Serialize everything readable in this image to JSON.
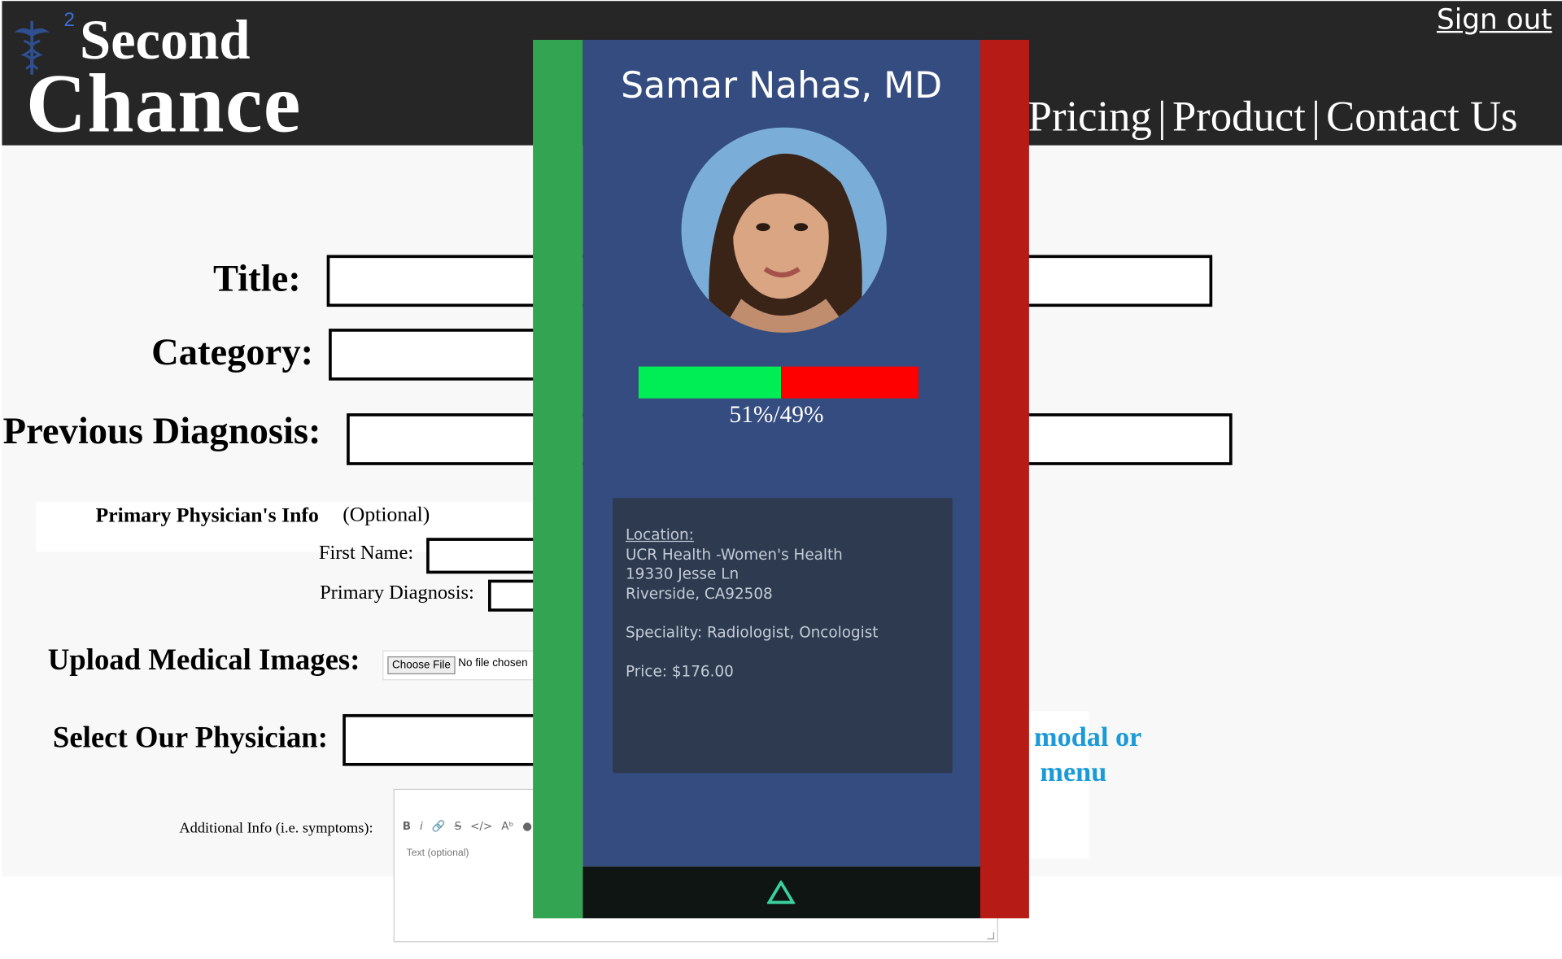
{
  "header": {
    "logo_superscript": "2",
    "logo_line1": "Second",
    "logo_line2": "Chance",
    "signout_label": "Sign out",
    "nav": [
      "Pricing",
      "Product",
      "Contact Us"
    ],
    "nav_separator": "|"
  },
  "form": {
    "title_label": "Title:",
    "category_label": "Category:",
    "previous_diagnosis_label": "Previous Diagnosis:",
    "physician_info_heading": "Primary Physician's Info",
    "physician_info_optional": "(Optional)",
    "first_name_label": "First Name:",
    "primary_diagnosis_label": "Primary Diagnosis:",
    "upload_label": "Upload Medical Images:",
    "choose_file_label": "Choose File",
    "no_file_label": "No file chosen",
    "select_physician_label": "Select Our Physician:",
    "additional_info_label": "Additional Info (i.e. symptoms):",
    "editor_placeholder": "Text (optional)",
    "toolbar_icons": [
      "bold-icon",
      "italic-icon",
      "link-icon",
      "strikethrough-icon",
      "code-icon",
      "font-size-icon",
      "info-icon"
    ],
    "modal_hint": [
      "modal or",
      "menu"
    ]
  },
  "physician_card": {
    "name": "Samar Nahas, MD",
    "ratio": {
      "positive": 0.51,
      "negative": 0.49,
      "label": "51%/49%"
    },
    "location_label": "Location:",
    "location_lines": [
      "UCR Health -Women's Health",
      "19330 Jesse Ln",
      "Riverside, CA92508"
    ],
    "speciality": "Speciality: Radiologist, Oncologist",
    "price": "Price: $176.00",
    "colors": {
      "accept": "#33a451",
      "reject": "#b71b16",
      "panel": "#344c7f",
      "footer": "#0f1512",
      "triangle": "#3ad29f"
    },
    "footer_icon": "triangle-up-icon"
  }
}
